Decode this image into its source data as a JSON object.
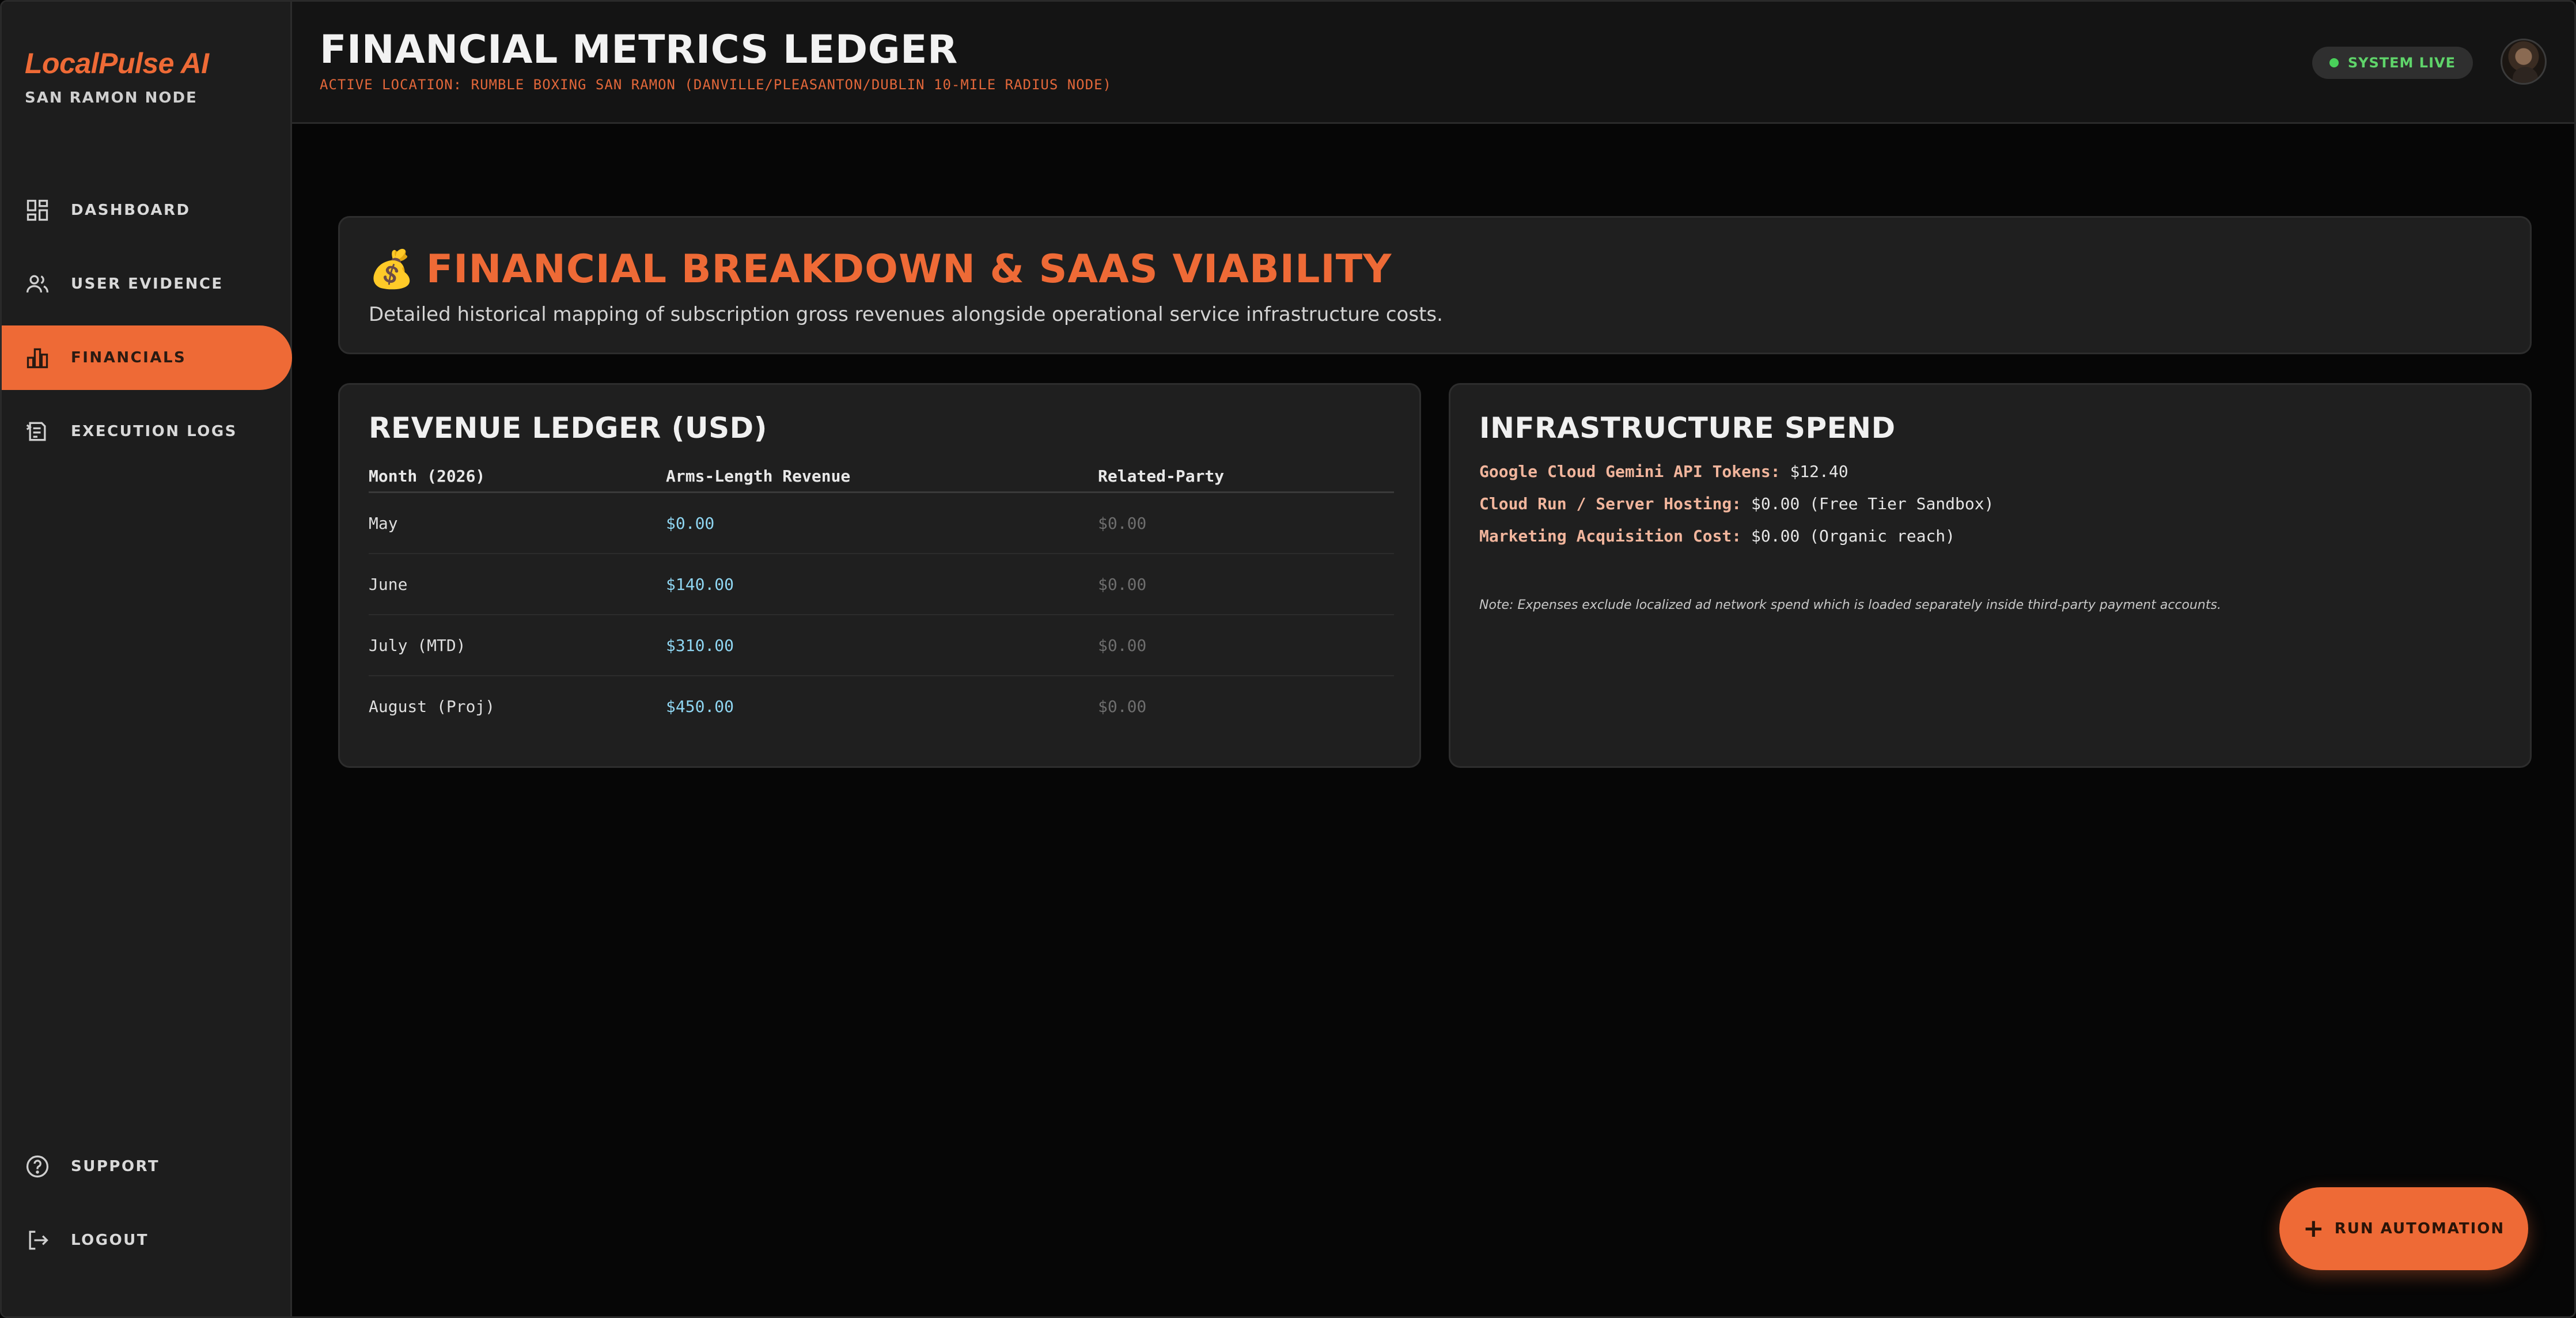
{
  "sidebar": {
    "brand": "LocalPulse AI",
    "node": "SAN RAMON NODE",
    "nav": [
      {
        "label": "DASHBOARD",
        "icon": "dashboard-icon"
      },
      {
        "label": "USER EVIDENCE",
        "icon": "users-icon"
      },
      {
        "label": "FINANCIALS",
        "icon": "bar-chart-icon",
        "active": true
      },
      {
        "label": "EXECUTION LOGS",
        "icon": "logs-icon"
      }
    ],
    "bottom": [
      {
        "label": "SUPPORT",
        "icon": "help-icon"
      },
      {
        "label": "LOGOUT",
        "icon": "logout-icon"
      }
    ]
  },
  "header": {
    "title": "FINANCIAL METRICS LEDGER",
    "subtitle": "ACTIVE LOCATION: RUMBLE BOXING SAN RAMON (DANVILLE/PLEASANTON/DUBLIN 10-MILE RADIUS NODE)",
    "status": "SYSTEM LIVE",
    "status_color": "#49d05a"
  },
  "hero": {
    "icon": "💰",
    "title": "FINANCIAL BREAKDOWN & SAAS VIABILITY",
    "description": "Detailed historical mapping of subscription gross revenues alongside operational service infrastructure costs."
  },
  "ledger": {
    "title": "REVENUE LEDGER (USD)",
    "columns": [
      "Month (2026)",
      "Arms-Length Revenue",
      "Related-Party"
    ],
    "rows": [
      {
        "month": "May",
        "revenue": "$0.00",
        "related": "$0.00"
      },
      {
        "month": "June",
        "revenue": "$140.00",
        "related": "$0.00"
      },
      {
        "month": "July (MTD)",
        "revenue": "$310.00",
        "related": "$0.00"
      },
      {
        "month": "August (Proj)",
        "revenue": "$450.00",
        "related": "$0.00"
      }
    ]
  },
  "infra": {
    "title": "INFRASTRUCTURE SPEND",
    "items": [
      {
        "label": "Google Cloud Gemini API Tokens:",
        "value": "$12.40"
      },
      {
        "label": "Cloud Run / Server Hosting:",
        "value": "$0.00 (Free Tier Sandbox)"
      },
      {
        "label": "Marketing Acquisition Cost:",
        "value": "$0.00 (Organic reach)"
      }
    ],
    "note": "Note: Expenses exclude localized ad network spend which is loaded separately inside third-party payment accounts."
  },
  "fab": {
    "label": "RUN AUTOMATION"
  },
  "colors": {
    "accent": "#ee6a36",
    "revenue": "#8fd6f2",
    "muted": "#6e6e6e"
  }
}
